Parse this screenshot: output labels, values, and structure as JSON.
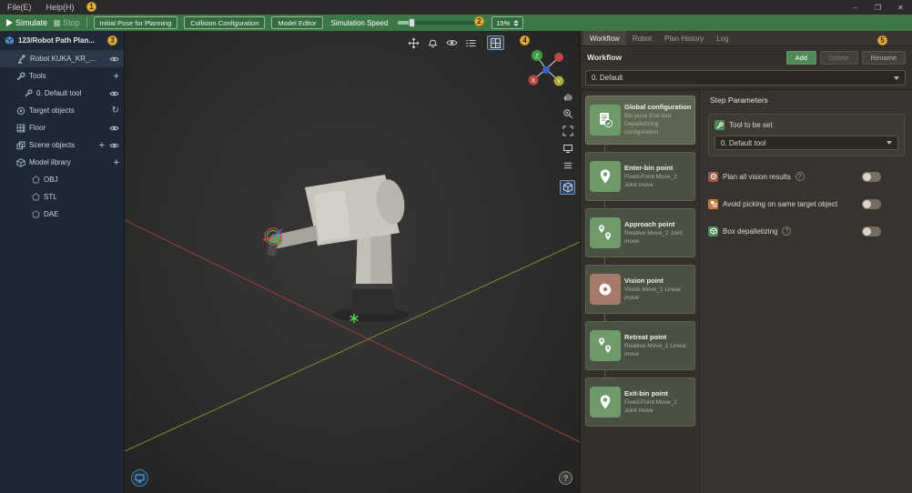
{
  "annotations": [
    "1",
    "2",
    "3",
    "4",
    "5"
  ],
  "menu_bar": {
    "file": "File(E)",
    "help": "Help(H)",
    "minimize": "–",
    "maximize": "❐",
    "close": "✕"
  },
  "toolbar": {
    "simulate": "Simulate",
    "stop": "Stop",
    "initial_pose": "Initial Pose for Planning",
    "collision_config": "Collision Configuration",
    "model_editor": "Model Editor",
    "speed_label": "Simulation Speed",
    "speed_value": "15%"
  },
  "sidebar": {
    "header": "123/Robot Path Plan...",
    "items": [
      {
        "label": "Robot KUKA_KR_..."
      },
      {
        "label": "Tools"
      },
      {
        "label": "0. Default tool"
      },
      {
        "label": "Target objects"
      },
      {
        "label": "Floor"
      },
      {
        "label": "Scene objects"
      },
      {
        "label": "Model library"
      },
      {
        "label": "OBJ"
      },
      {
        "label": "STL"
      },
      {
        "label": "DAE"
      }
    ]
  },
  "viewport": {
    "axis_x": "X",
    "axis_y": "Y",
    "axis_z": "Z",
    "help": "?"
  },
  "workflow_panel": {
    "tabs": [
      {
        "label": "Workflow"
      },
      {
        "label": "Robot"
      },
      {
        "label": "Plan History"
      },
      {
        "label": "Log"
      }
    ],
    "section_title": "Workflow",
    "add": "Add",
    "delete": "Delete",
    "rename": "Rename",
    "selected_workflow": "0. Default",
    "steps": [
      {
        "title": "Global configuration",
        "subtitle": "Bin pose  End tool  Depalletizing configuration"
      },
      {
        "title": "Enter-bin point",
        "subtitle": "Fixed-Point Move_2  Joint move"
      },
      {
        "title": "Approach point",
        "subtitle": "Relative Move_2  Joint move"
      },
      {
        "title": "Vision point",
        "subtitle": "Vision Move_1  Linear move"
      },
      {
        "title": "Retreat point",
        "subtitle": "Relative Move_1  Linear move"
      },
      {
        "title": "Exit-bin point",
        "subtitle": "Fixed-Point Move_1  Joint move"
      }
    ]
  },
  "step_parameters": {
    "title": "Step Parameters",
    "tool_label": "Tool to be set",
    "tool_value": "0. Default tool",
    "toggles": [
      {
        "label": "Plan all vision results",
        "help": "?",
        "state": "off"
      },
      {
        "label": "Avoid picking on same target object",
        "state": "off"
      },
      {
        "label": "Box depalletizing",
        "help": "?",
        "state": "off"
      }
    ]
  },
  "colors": {
    "toolbar_green": "#3c7747",
    "accent_green": "#4f8a58",
    "badge_yellow": "#e9b23c",
    "step_card_green": "#6f9b6b",
    "vision_red": "#a5796b",
    "sidebar_navy": "#1e2935",
    "panel_brown": "#34302b"
  }
}
